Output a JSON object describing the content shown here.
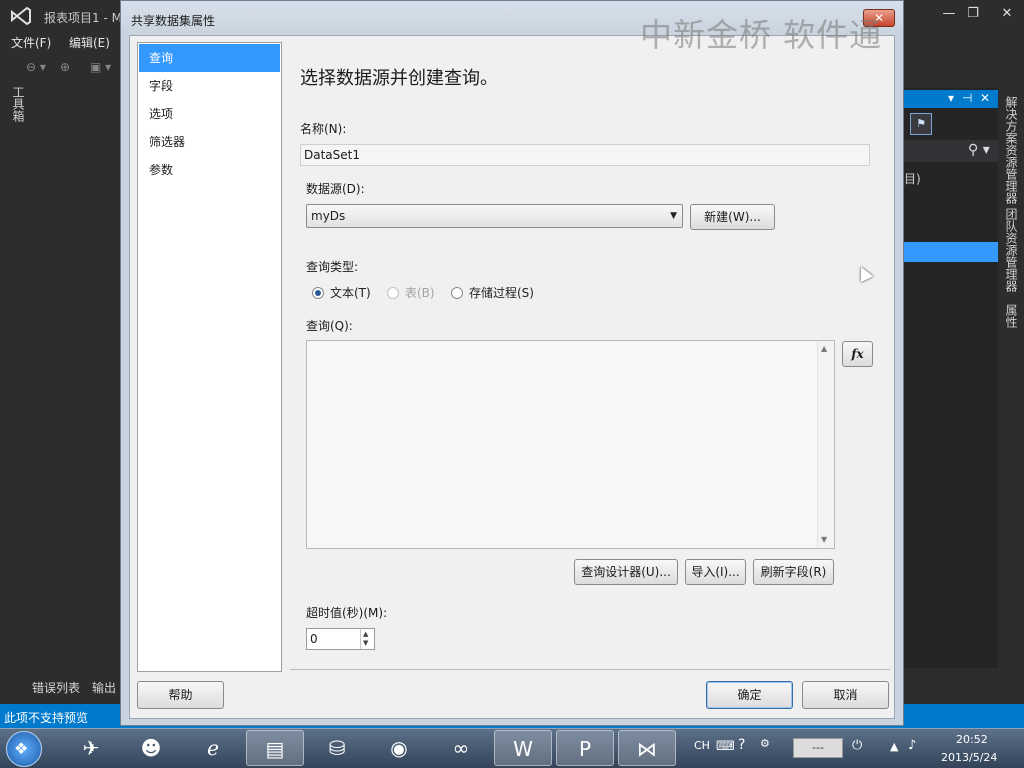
{
  "vs": {
    "title": "报表项目1 - M",
    "menu": [
      "文件(F)",
      "编辑(E)"
    ],
    "toolbox": "工具箱",
    "bottom_tabs": [
      "错误列表",
      "输出"
    ],
    "status": "此项不支持预览",
    "right_panel_text": "目)",
    "right_tabs": [
      "解决方案资源管理器",
      "团队资源管理器",
      "属性"
    ],
    "win_controls": [
      "—",
      "❐",
      "✕"
    ]
  },
  "watermark": "中新金桥  软件通",
  "dialog": {
    "title": "共享数据集属性",
    "close_label": "✕",
    "nav": [
      "查询",
      "字段",
      "选项",
      "筛选器",
      "参数"
    ],
    "heading": "选择数据源并创建查询。",
    "name_label": "名称(N):",
    "name_value": "DataSet1",
    "datasource_label": "数据源(D):",
    "datasource_value": "myDs",
    "new_button": "新建(W)...",
    "query_type_label": "查询类型:",
    "query_types": [
      {
        "label": "文本(T)",
        "selected": true,
        "enabled": true
      },
      {
        "label": "表(B)",
        "selected": false,
        "enabled": false
      },
      {
        "label": "存储过程(S)",
        "selected": false,
        "enabled": true
      }
    ],
    "query_label": "查询(Q):",
    "query_text": "",
    "fx_label": "fx",
    "query_designer_button": "查询设计器(U)...",
    "import_button": "导入(I)...",
    "refresh_fields_button": "刷新字段(R)",
    "timeout_label": "超时值(秒)(M):",
    "timeout_value": "0",
    "help_button": "帮助",
    "ok_button": "确定",
    "cancel_button": "取消"
  },
  "taskbar": {
    "lang": "CH",
    "input_box": "---",
    "time": "20:52",
    "date": "2013/5/24"
  }
}
